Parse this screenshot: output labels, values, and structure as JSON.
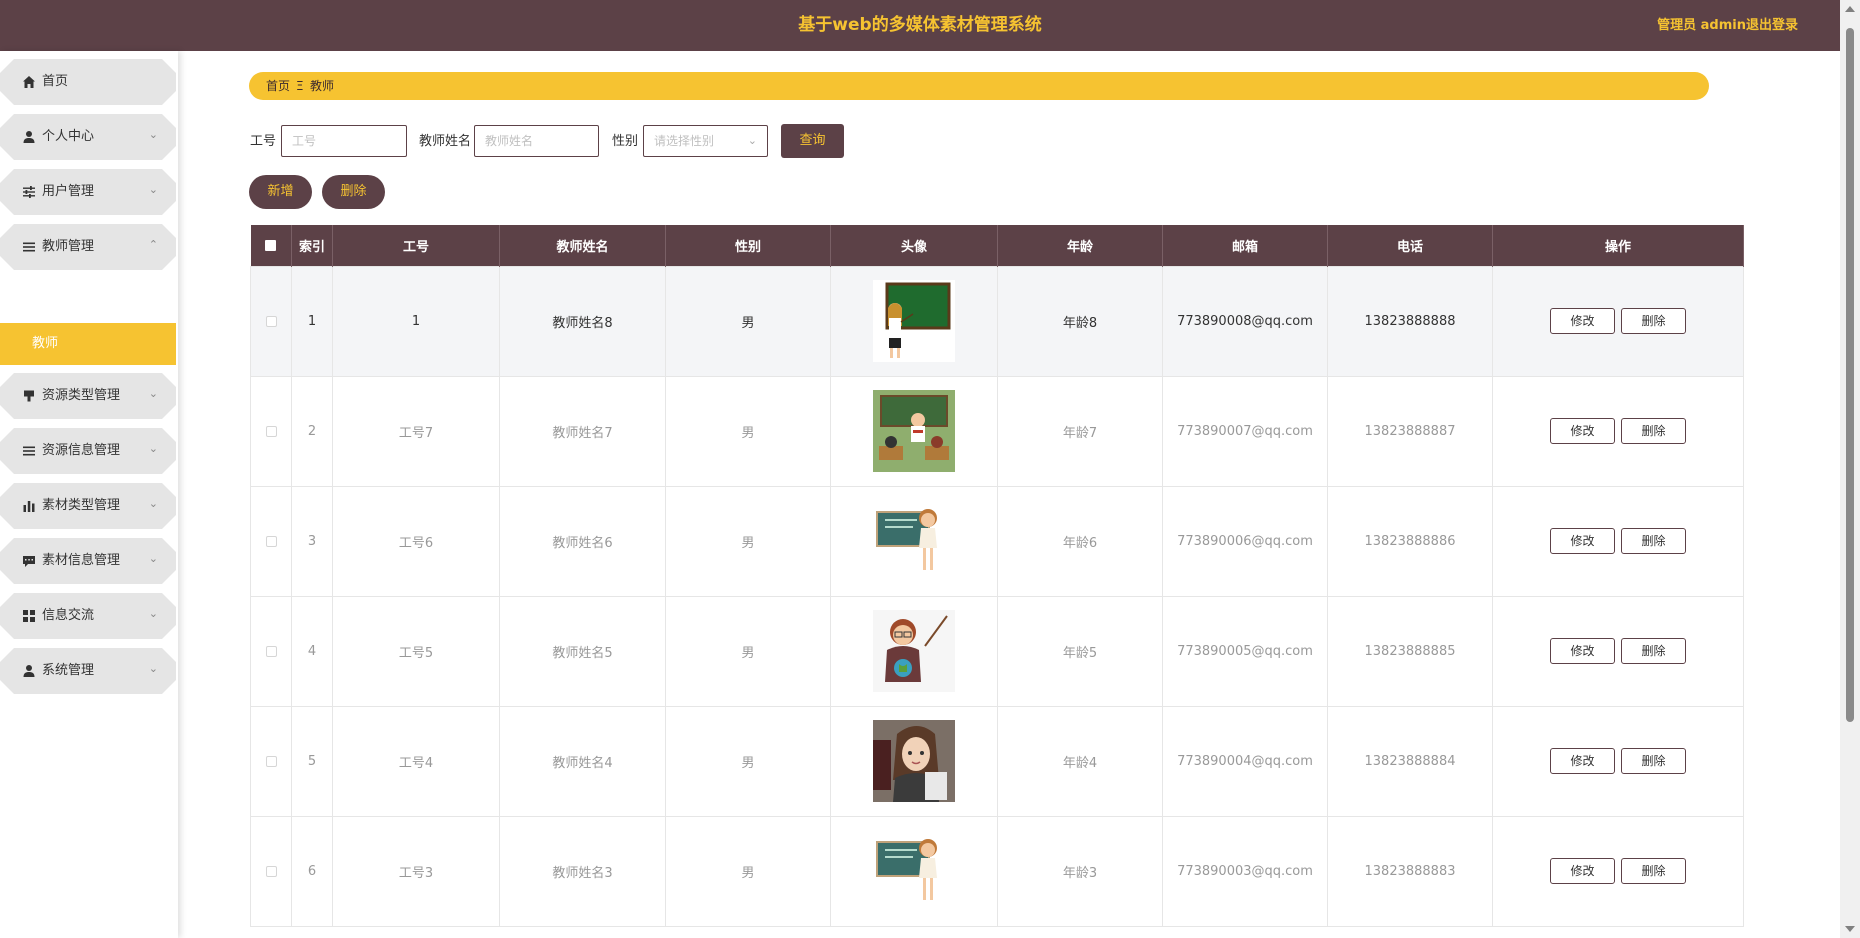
{
  "header": {
    "title": "基于web的多媒体素材管理系统",
    "admin": "管理员 admin",
    "logout": "退出登录"
  },
  "sidebar": {
    "items": [
      {
        "label": "首页",
        "icon": "home-icon",
        "has_chevron": false,
        "chevron": ""
      },
      {
        "label": "个人中心",
        "icon": "user-icon",
        "has_chevron": true,
        "chevron": "⌄"
      },
      {
        "label": "用户管理",
        "icon": "sliders-icon",
        "has_chevron": true,
        "chevron": "⌄"
      },
      {
        "label": "教师管理",
        "icon": "list-icon",
        "has_chevron": true,
        "chevron": "⌃"
      },
      {
        "label": "资源类型管理",
        "icon": "stamp-icon",
        "has_chevron": true,
        "chevron": "⌄"
      },
      {
        "label": "资源信息管理",
        "icon": "list-icon",
        "has_chevron": true,
        "chevron": "⌄"
      },
      {
        "label": "素材类型管理",
        "icon": "bar-chart-icon",
        "has_chevron": true,
        "chevron": "⌄"
      },
      {
        "label": "素材信息管理",
        "icon": "comment-icon",
        "has_chevron": true,
        "chevron": "⌄"
      },
      {
        "label": "信息交流",
        "icon": "grid-icon",
        "has_chevron": true,
        "chevron": "⌄"
      },
      {
        "label": "系统管理",
        "icon": "user-icon",
        "has_chevron": true,
        "chevron": "⌄"
      }
    ],
    "active_sub": "教师"
  },
  "breadcrumb": {
    "home": "首页",
    "separator": "Ξ",
    "current": "教师"
  },
  "search": {
    "id_label": "工号",
    "id_placeholder": "工号",
    "name_label": "教师姓名",
    "name_placeholder": "教师姓名",
    "gender_label": "性别",
    "gender_placeholder": "请选择性别",
    "query_button": "查询"
  },
  "actions": {
    "add": "新增",
    "delete": "删除"
  },
  "table": {
    "headers": [
      "索引",
      "工号",
      "教师姓名",
      "性别",
      "头像",
      "年龄",
      "邮箱",
      "电话",
      "操作"
    ],
    "edit_label": "修改",
    "delete_label": "删除",
    "rows": [
      {
        "index": "1",
        "id": "1",
        "name": "教师姓名8",
        "gender": "男",
        "avatar": "teacher-at-blackboard",
        "age": "年龄8",
        "email": "773890008@qq.com",
        "phone": "13823888888"
      },
      {
        "index": "2",
        "id": "工号7",
        "name": "教师姓名7",
        "gender": "男",
        "avatar": "teacher-classroom",
        "age": "年龄7",
        "email": "773890007@qq.com",
        "phone": "13823888887"
      },
      {
        "index": "3",
        "id": "工号6",
        "name": "教师姓名6",
        "gender": "男",
        "avatar": "teacher-chalkboard",
        "age": "年龄6",
        "email": "773890006@qq.com",
        "phone": "13823888886"
      },
      {
        "index": "4",
        "id": "工号5",
        "name": "教师姓名5",
        "gender": "男",
        "avatar": "teacher-globe",
        "age": "年龄5",
        "email": "773890005@qq.com",
        "phone": "13823888885"
      },
      {
        "index": "5",
        "id": "工号4",
        "name": "教师姓名4",
        "gender": "男",
        "avatar": "teacher-portrait",
        "age": "年龄4",
        "email": "773890004@qq.com",
        "phone": "13823888884"
      },
      {
        "index": "6",
        "id": "工号3",
        "name": "教师姓名3",
        "gender": "男",
        "avatar": "teacher-chalkboard",
        "age": "年龄3",
        "email": "773890003@qq.com",
        "phone": "13823888883"
      }
    ]
  },
  "colors": {
    "primary": "#5c4147",
    "accent": "#f6c331",
    "menu_bg": "#e5e5e5"
  }
}
